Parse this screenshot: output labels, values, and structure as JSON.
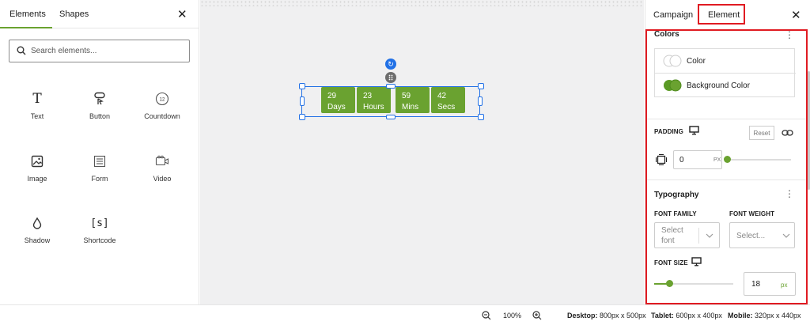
{
  "left_panel": {
    "tabs": [
      {
        "label": "Elements"
      },
      {
        "label": "Shapes"
      }
    ],
    "close": "✕",
    "search": {
      "placeholder": "Search elements...",
      "value": ""
    },
    "elements": [
      {
        "label": "Text",
        "icon": "text-icon"
      },
      {
        "label": "Button",
        "icon": "button-icon"
      },
      {
        "label": "Countdown",
        "icon": "countdown-icon"
      },
      {
        "label": "Image",
        "icon": "image-icon"
      },
      {
        "label": "Form",
        "icon": "form-icon"
      },
      {
        "label": "Video",
        "icon": "video-icon"
      },
      {
        "label": "Shadow",
        "icon": "shadow-icon"
      },
      {
        "label": "Shortcode",
        "icon": "shortcode-icon"
      }
    ],
    "countdown_icon_text": "12",
    "shortcode_icon_text": "[s]",
    "text_icon_text": "T"
  },
  "canvas": {
    "countdown": [
      {
        "value": "29",
        "unit": "Days"
      },
      {
        "value": "23",
        "unit": "Hours"
      },
      {
        "value": "59",
        "unit": "Mins"
      },
      {
        "value": "42",
        "unit": "Secs"
      }
    ],
    "accent_color": "#6aa230",
    "selection_color": "#2271e6"
  },
  "right_panel": {
    "tabs": [
      {
        "label": "Campaign"
      },
      {
        "label": "Element"
      }
    ],
    "close": "✕",
    "colors": {
      "title": "Colors",
      "items": [
        {
          "label": "Color"
        },
        {
          "label": "Background Color"
        }
      ]
    },
    "padding": {
      "label": "PADDING",
      "reset_label": "Reset",
      "value": "0",
      "unit": "PX"
    },
    "typography": {
      "title": "Typography",
      "font_family_label": "FONT FAMILY",
      "font_family_placeholder": "Select font",
      "font_weight_label": "FONT WEIGHT",
      "font_weight_placeholder": "Select...",
      "font_size_label": "FONT SIZE",
      "font_size_value": "18",
      "font_size_unit": "px"
    },
    "highlight_color": "#e01b22"
  },
  "bottom_bar": {
    "zoom": "100%",
    "desktop_label": "Desktop:",
    "desktop_value": "800px x 500px",
    "tablet_label": "Tablet:",
    "tablet_value": "600px x 400px",
    "mobile_label": "Mobile:",
    "mobile_value": "320px x 440px"
  }
}
